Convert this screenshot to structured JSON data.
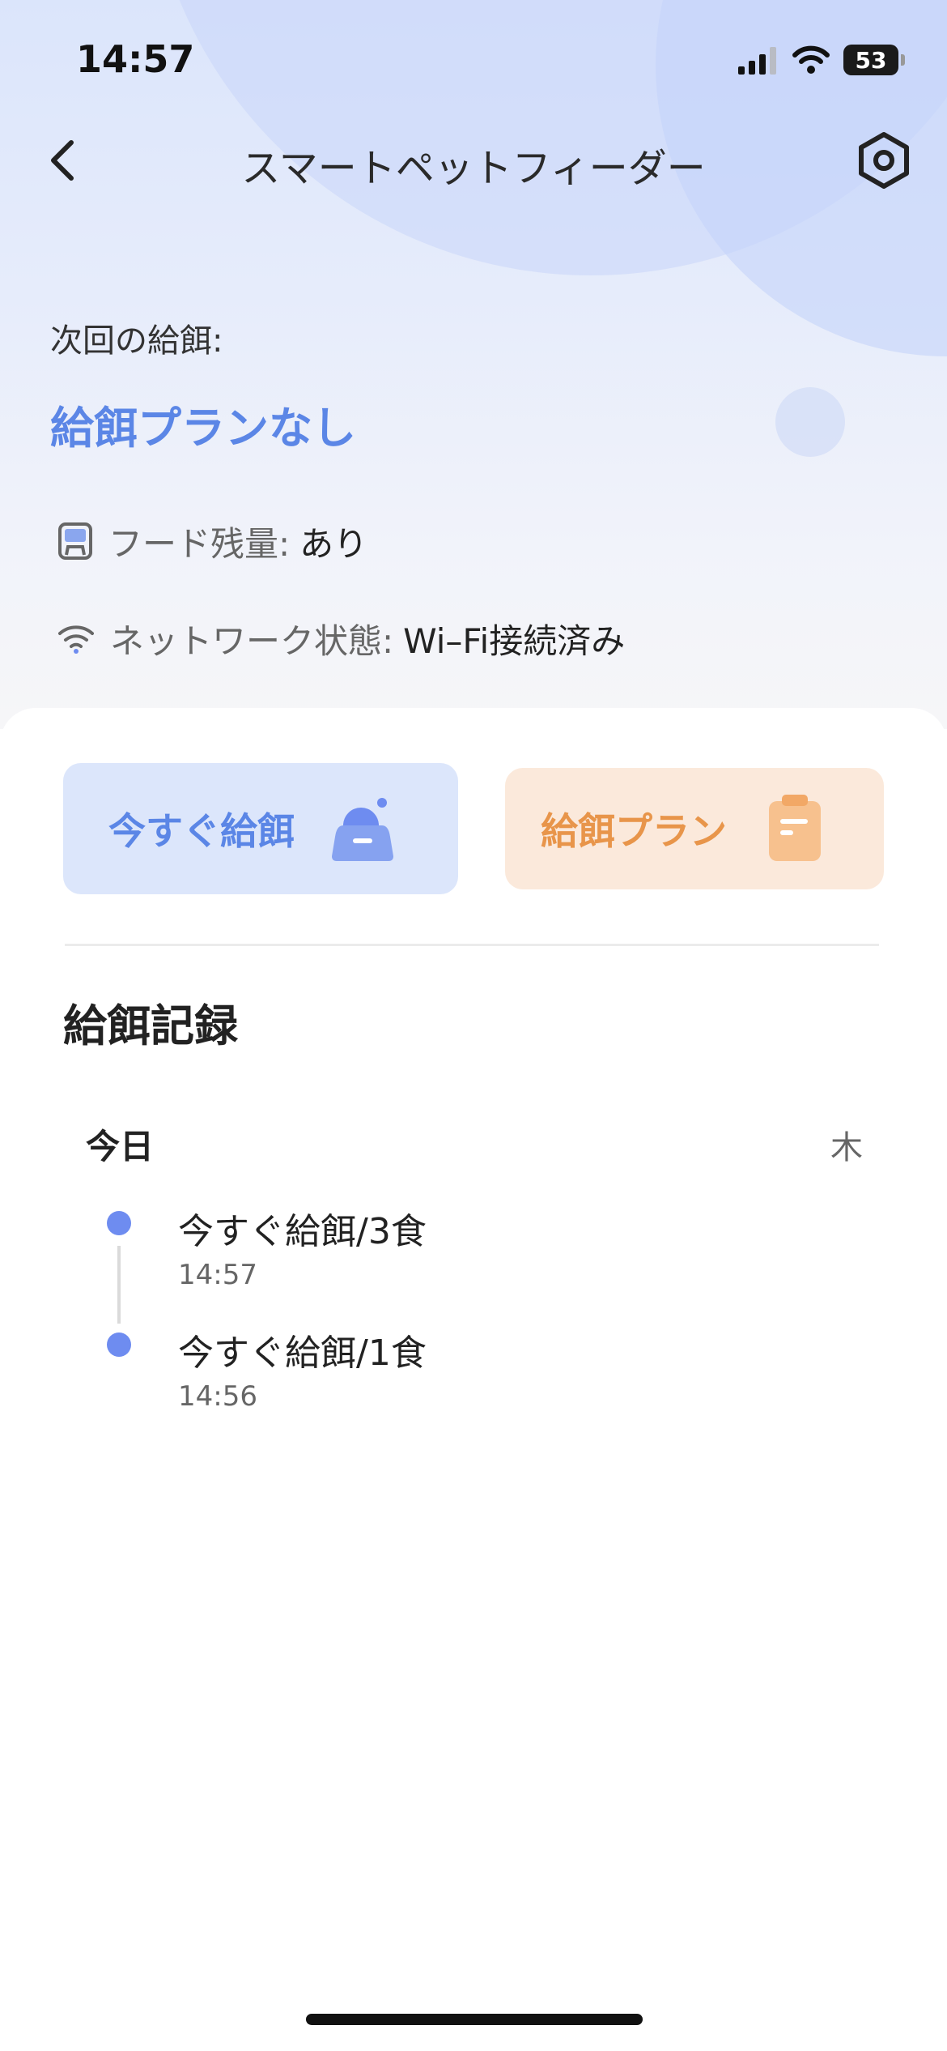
{
  "status_bar": {
    "time": "14:57",
    "battery_level": "53"
  },
  "header": {
    "title": "スマートペットフィーダー"
  },
  "next_feeding": {
    "label": "次回の給餌:",
    "value": "給餌プランなし"
  },
  "food_status": {
    "label": "フード残量:",
    "value": "あり"
  },
  "network_status": {
    "label": "ネットワーク状態:",
    "value": "Wi–Fi接続済み"
  },
  "actions": {
    "feed_now": "今すぐ給餌",
    "feeding_plan": "給餌プラン"
  },
  "records": {
    "heading": "給餌記録",
    "day": "今日",
    "weekday": "木",
    "items": [
      {
        "title": "今すぐ給餌/3食",
        "time": "14:57"
      },
      {
        "title": "今すぐ給餌/1食",
        "time": "14:56"
      }
    ]
  },
  "colors": {
    "accent_blue": "#5b86e6",
    "accent_orange": "#e8954a",
    "timeline_dot": "#6e8cf0"
  }
}
